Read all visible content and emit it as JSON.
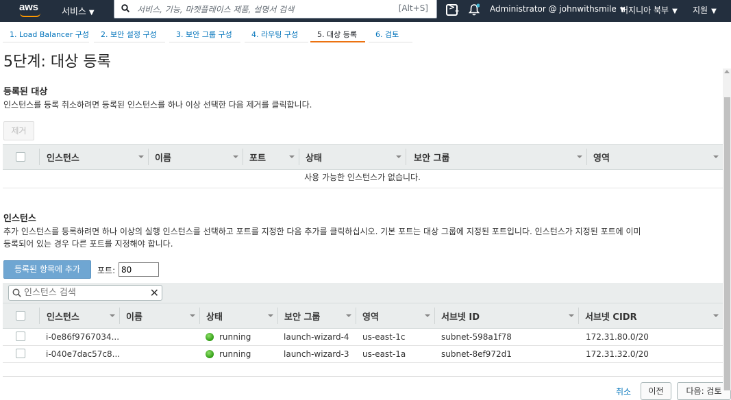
{
  "topnav": {
    "logo": "aws",
    "services": "서비스",
    "search_placeholder": "서비스, 기능, 마켓플레이스 제품, 설명서 검색",
    "search_shortcut": "[Alt+S]",
    "account": "Administrator @ johnwithsmile",
    "region": "버지니아 북부",
    "support": "지원",
    "icons": [
      "cloudshell-icon",
      "bell-icon"
    ]
  },
  "steps": [
    {
      "label": "1. Load Balancer 구성",
      "active": false
    },
    {
      "label": "2. 보안 설정 구성",
      "active": false
    },
    {
      "label": "3. 보안 그룹 구성",
      "active": false
    },
    {
      "label": "4. 라우팅 구성",
      "active": false
    },
    {
      "label": "5. 대상 등록",
      "active": true
    },
    {
      "label": "6. 검토",
      "active": false
    }
  ],
  "page_title": "5단계: 대상 등록",
  "registered": {
    "title": "등록된 대상",
    "description": "인스턴스를 등록 취소하려면 등록된 인스턴스를 하나 이상 선택한 다음 제거를 클릭합니다.",
    "remove_label": "제거",
    "columns": [
      "인스턴스",
      "이름",
      "포트",
      "상태",
      "보안 그룹",
      "영역"
    ],
    "empty_message": "사용 가능한 인스턴스가 없습니다."
  },
  "instances": {
    "title": "인스턴스",
    "description_line1": "추가 인스턴스를 등록하려면 하나 이상의 실행 인스턴스를 선택하고 포트를 지정한 다음 추가를 클릭하십시오. 기본 포트는 대상 그룹에 지정된 포트입니다. 인스턴스가 지정된 포트에 이미",
    "description_line2": "등록되어 있는 경우 다른 포트를 지정해야 합니다.",
    "add_label": "등록된 항목에 추가",
    "port_label": "포트:",
    "port_value": "80",
    "search_placeholder": "인스턴스 검색",
    "columns": [
      "인스턴스",
      "이름",
      "상태",
      "보안 그룹",
      "영역",
      "서브넷 ID",
      "서브넷 CIDR"
    ],
    "rows": [
      {
        "instance": "i-0e86f9767034...",
        "name": "",
        "state": "running",
        "security_group": "launch-wizard-4",
        "zone": "us-east-1c",
        "subnet_id": "subnet-598a1f78",
        "subnet_cidr": "172.31.80.0/20"
      },
      {
        "instance": "i-040e7dac57c8...",
        "name": "",
        "state": "running",
        "security_group": "launch-wizard-3",
        "zone": "us-east-1a",
        "subnet_id": "subnet-8ef972d1",
        "subnet_cidr": "172.31.32.0/20"
      }
    ]
  },
  "footer": {
    "cancel_label": "취소",
    "previous_label": "이전",
    "next_label": "다음: 검토"
  }
}
